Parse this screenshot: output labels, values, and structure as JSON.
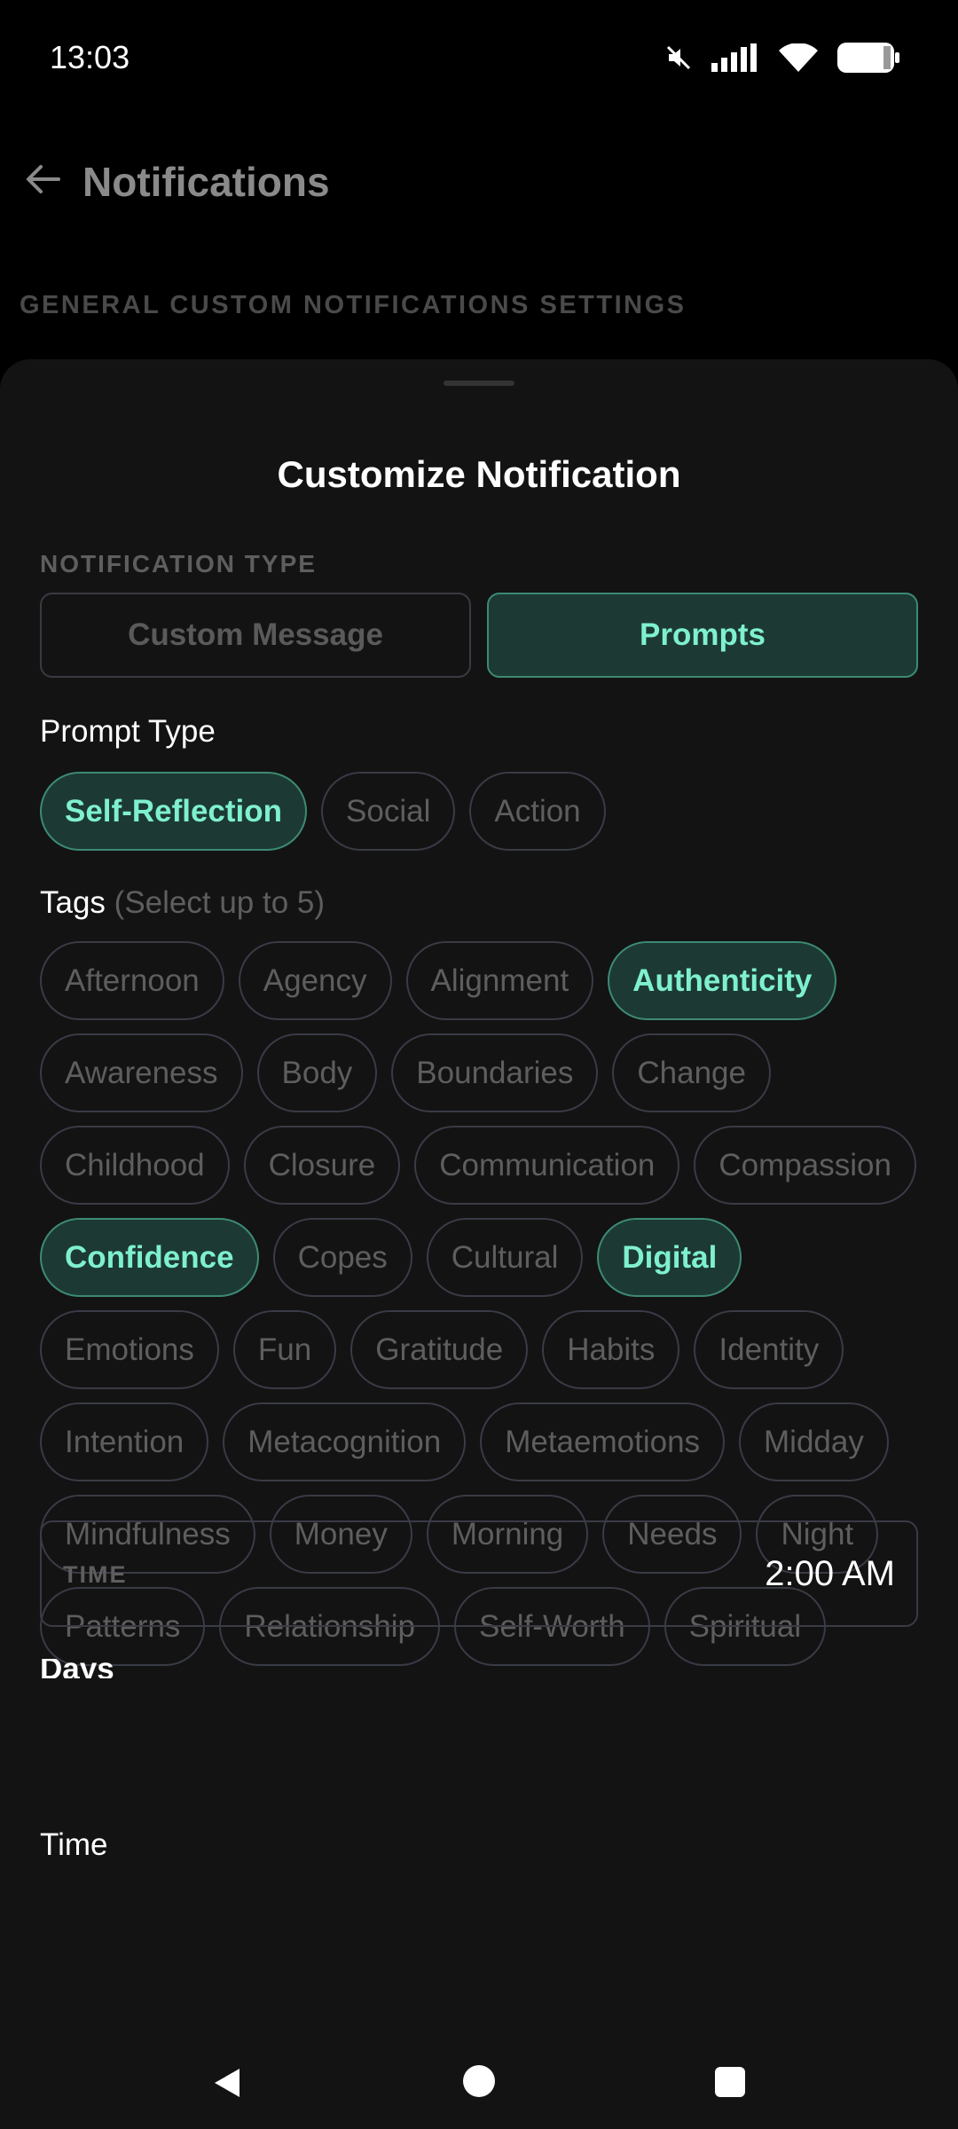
{
  "status_bar": {
    "time": "13:03",
    "icons": [
      "mute-icon",
      "signal-icon",
      "wifi-icon",
      "battery-icon"
    ]
  },
  "background_screen": {
    "title": "Notifications",
    "section_label": "GENERAL CUSTOM NOTIFICATIONS SETTINGS"
  },
  "sheet": {
    "title": "Customize Notification",
    "notification_type": {
      "label": "NOTIFICATION TYPE",
      "options": [
        {
          "label": "Custom Message",
          "selected": false
        },
        {
          "label": "Prompts",
          "selected": true
        }
      ]
    },
    "prompt_type": {
      "label": "Prompt Type",
      "options": [
        {
          "label": "Self-Reflection",
          "selected": true
        },
        {
          "label": "Social",
          "selected": false
        },
        {
          "label": "Action",
          "selected": false
        }
      ]
    },
    "tags": {
      "label": "Tags",
      "hint": "(Select up to 5)",
      "options": [
        {
          "label": "Afternoon",
          "selected": false
        },
        {
          "label": "Agency",
          "selected": false
        },
        {
          "label": "Alignment",
          "selected": false
        },
        {
          "label": "Authenticity",
          "selected": true
        },
        {
          "label": "Awareness",
          "selected": false
        },
        {
          "label": "Body",
          "selected": false
        },
        {
          "label": "Boundaries",
          "selected": false
        },
        {
          "label": "Change",
          "selected": false
        },
        {
          "label": "Childhood",
          "selected": false
        },
        {
          "label": "Closure",
          "selected": false
        },
        {
          "label": "Communication",
          "selected": false
        },
        {
          "label": "Compassion",
          "selected": false
        },
        {
          "label": "Confidence",
          "selected": true
        },
        {
          "label": "Copes",
          "selected": false
        },
        {
          "label": "Cultural",
          "selected": false
        },
        {
          "label": "Digital",
          "selected": true
        },
        {
          "label": "Emotions",
          "selected": false
        },
        {
          "label": "Fun",
          "selected": false
        },
        {
          "label": "Gratitude",
          "selected": false
        },
        {
          "label": "Habits",
          "selected": false
        },
        {
          "label": "Identity",
          "selected": false
        },
        {
          "label": "Intention",
          "selected": false
        },
        {
          "label": "Metacognition",
          "selected": false
        },
        {
          "label": "Metaemotions",
          "selected": false
        },
        {
          "label": "Midday",
          "selected": false
        },
        {
          "label": "Mindfulness",
          "selected": false
        },
        {
          "label": "Money",
          "selected": false
        },
        {
          "label": "Morning",
          "selected": false
        },
        {
          "label": "Needs",
          "selected": false
        },
        {
          "label": "Night",
          "selected": false
        },
        {
          "label": "Patterns",
          "selected": false
        },
        {
          "label": "Relationship",
          "selected": false
        },
        {
          "label": "Self-Worth",
          "selected": false
        },
        {
          "label": "Spiritual",
          "selected": false
        }
      ]
    },
    "time": {
      "label": "Time",
      "field_label": "TIME",
      "value": "2:00 AM"
    },
    "days": {
      "label": "Days"
    }
  },
  "colors": {
    "accent": "#7ff0cf",
    "accent_bg": "#1c3a33",
    "accent_border": "#3d8a74",
    "sheet_bg": "#131313",
    "muted_text": "#5e5e5e"
  }
}
